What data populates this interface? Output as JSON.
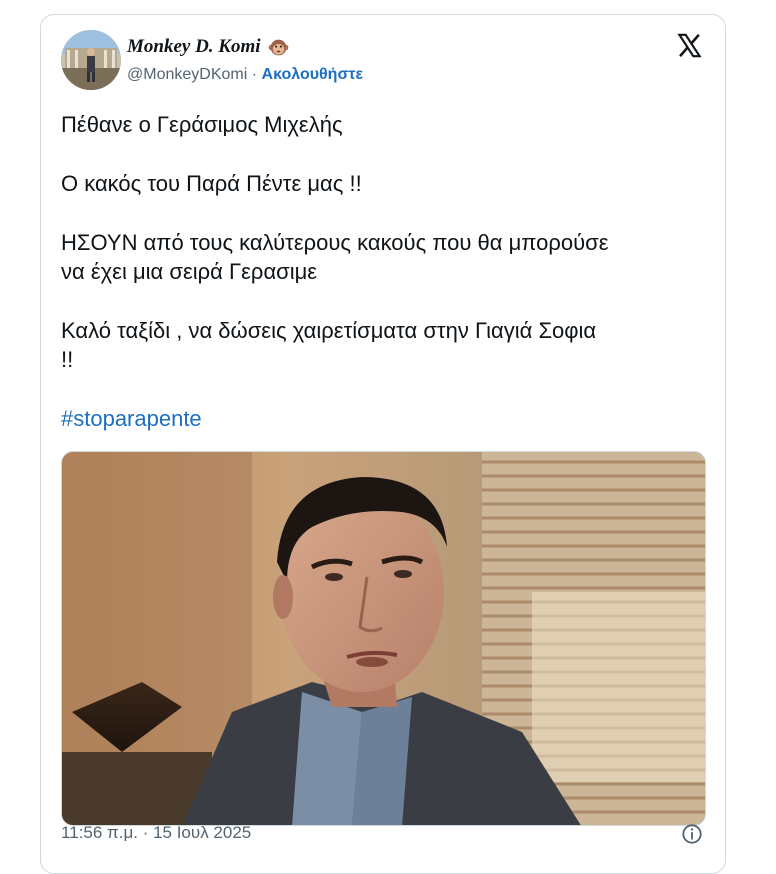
{
  "author": {
    "display_name": "Monkey D. Komi",
    "handle": "@MonkeyDKomi",
    "separator": "·",
    "follow_label": "Ακολουθήστε",
    "emoji_icon": "monkey-face-icon"
  },
  "tweet": {
    "line1": "Πέθανε ο Γεράσιμος Μιχελής",
    "line2": "Ο κακός του Παρά Πέντε μας !!",
    "line3a": "ΗΣΟΥΝ από τους καλύτερους κακούς που θα μπορούσε",
    "line3b": "να έχει μια σειρά Γερασιμε",
    "line4a": "Καλό ταξίδι , να δώσεις χαιρετίσματα στην Γιαγιά Σοφια",
    "line4b": "!!",
    "hashtag": "#stoparapente"
  },
  "meta": {
    "timestamp": "11:56 π.μ. · 15 Ιουλ 2025"
  },
  "icons": {
    "platform_logo": "x-logo-icon",
    "info": "info-icon"
  },
  "colors": {
    "link": "#1d6fbf",
    "text": "#0f1419",
    "secondary": "#536471",
    "border": "#cfd9de"
  }
}
